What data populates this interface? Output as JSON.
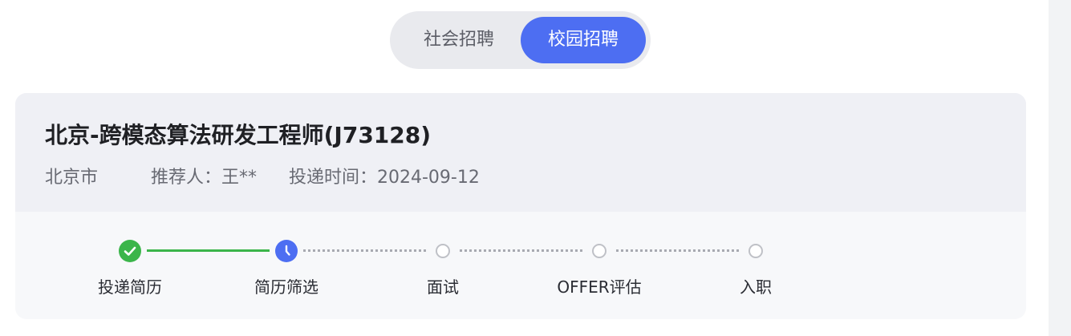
{
  "tabs": {
    "social": "社会招聘",
    "campus": "校园招聘",
    "active": "campus"
  },
  "job": {
    "title": "北京-跨模态算法研发工程师(J73128)",
    "city": "北京市",
    "referrer": "推荐人：王**",
    "submitted": "投递时间：2024-09-12"
  },
  "progress": {
    "steps": [
      {
        "label": "投递简历",
        "status": "done",
        "icon": "check-icon"
      },
      {
        "label": "简历筛选",
        "status": "current",
        "icon": "clock-icon"
      },
      {
        "label": "面试",
        "status": "pending",
        "icon": "empty-circle-icon"
      },
      {
        "label": "OFFER评估",
        "status": "pending",
        "icon": "empty-circle-icon"
      },
      {
        "label": "入职",
        "status": "pending",
        "icon": "empty-circle-icon"
      }
    ]
  },
  "colors": {
    "accent": "#4d6ef2",
    "done": "#3bb54a",
    "pending": "#bfc1c7"
  }
}
